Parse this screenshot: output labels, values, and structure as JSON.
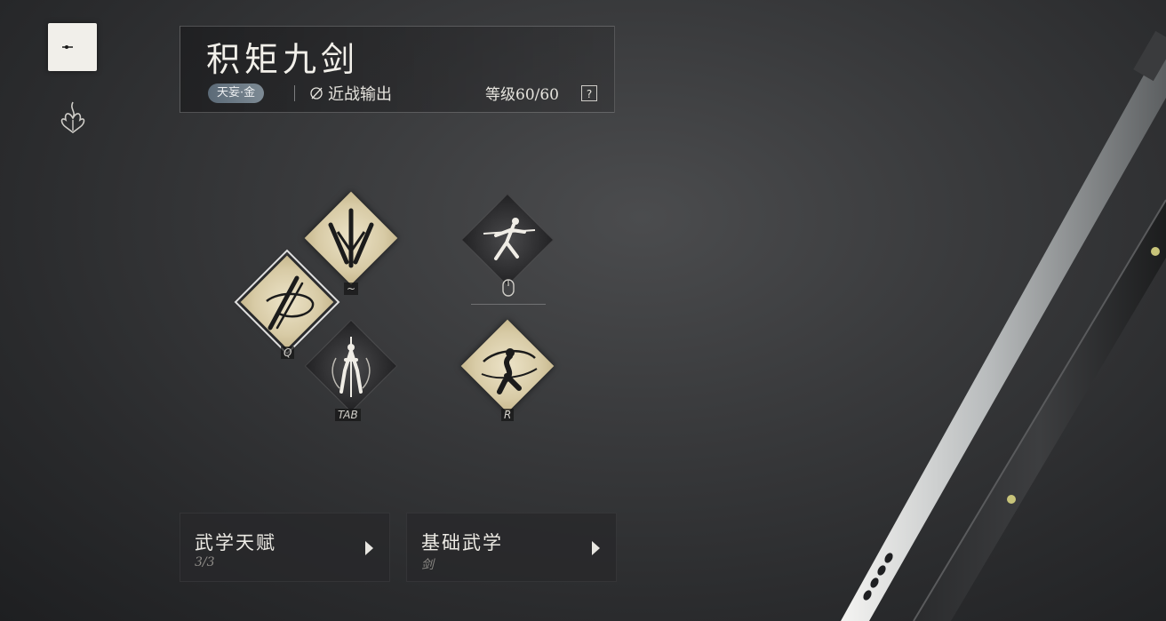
{
  "header": {
    "title": "积矩九剑",
    "tag": "天妄·金",
    "role_label": "近战输出",
    "level_text": "等级60/60",
    "help_label": "?"
  },
  "skills": [
    {
      "name": "skill-up",
      "key": "~",
      "style": "light"
    },
    {
      "name": "skill-left",
      "key": "Q",
      "style": "light",
      "selected": true
    },
    {
      "name": "skill-down",
      "key": "TAB",
      "style": "dark"
    },
    {
      "name": "skill-mouse",
      "key": "mouse",
      "style": "dark"
    },
    {
      "name": "skill-r",
      "key": "R",
      "style": "light"
    }
  ],
  "buttons": {
    "talent": {
      "label": "武学天赋",
      "sub": "3/3"
    },
    "basic": {
      "label": "基础武学",
      "sub": "剑"
    }
  },
  "icons": {
    "rail_active": "crescent-sword-icon",
    "rail_second": "flame-emblem-icon"
  },
  "colors": {
    "diamond_light": "#ddd0ad",
    "diamond_dark": "#2c2c2e",
    "tag_bg": "#6b7985"
  }
}
